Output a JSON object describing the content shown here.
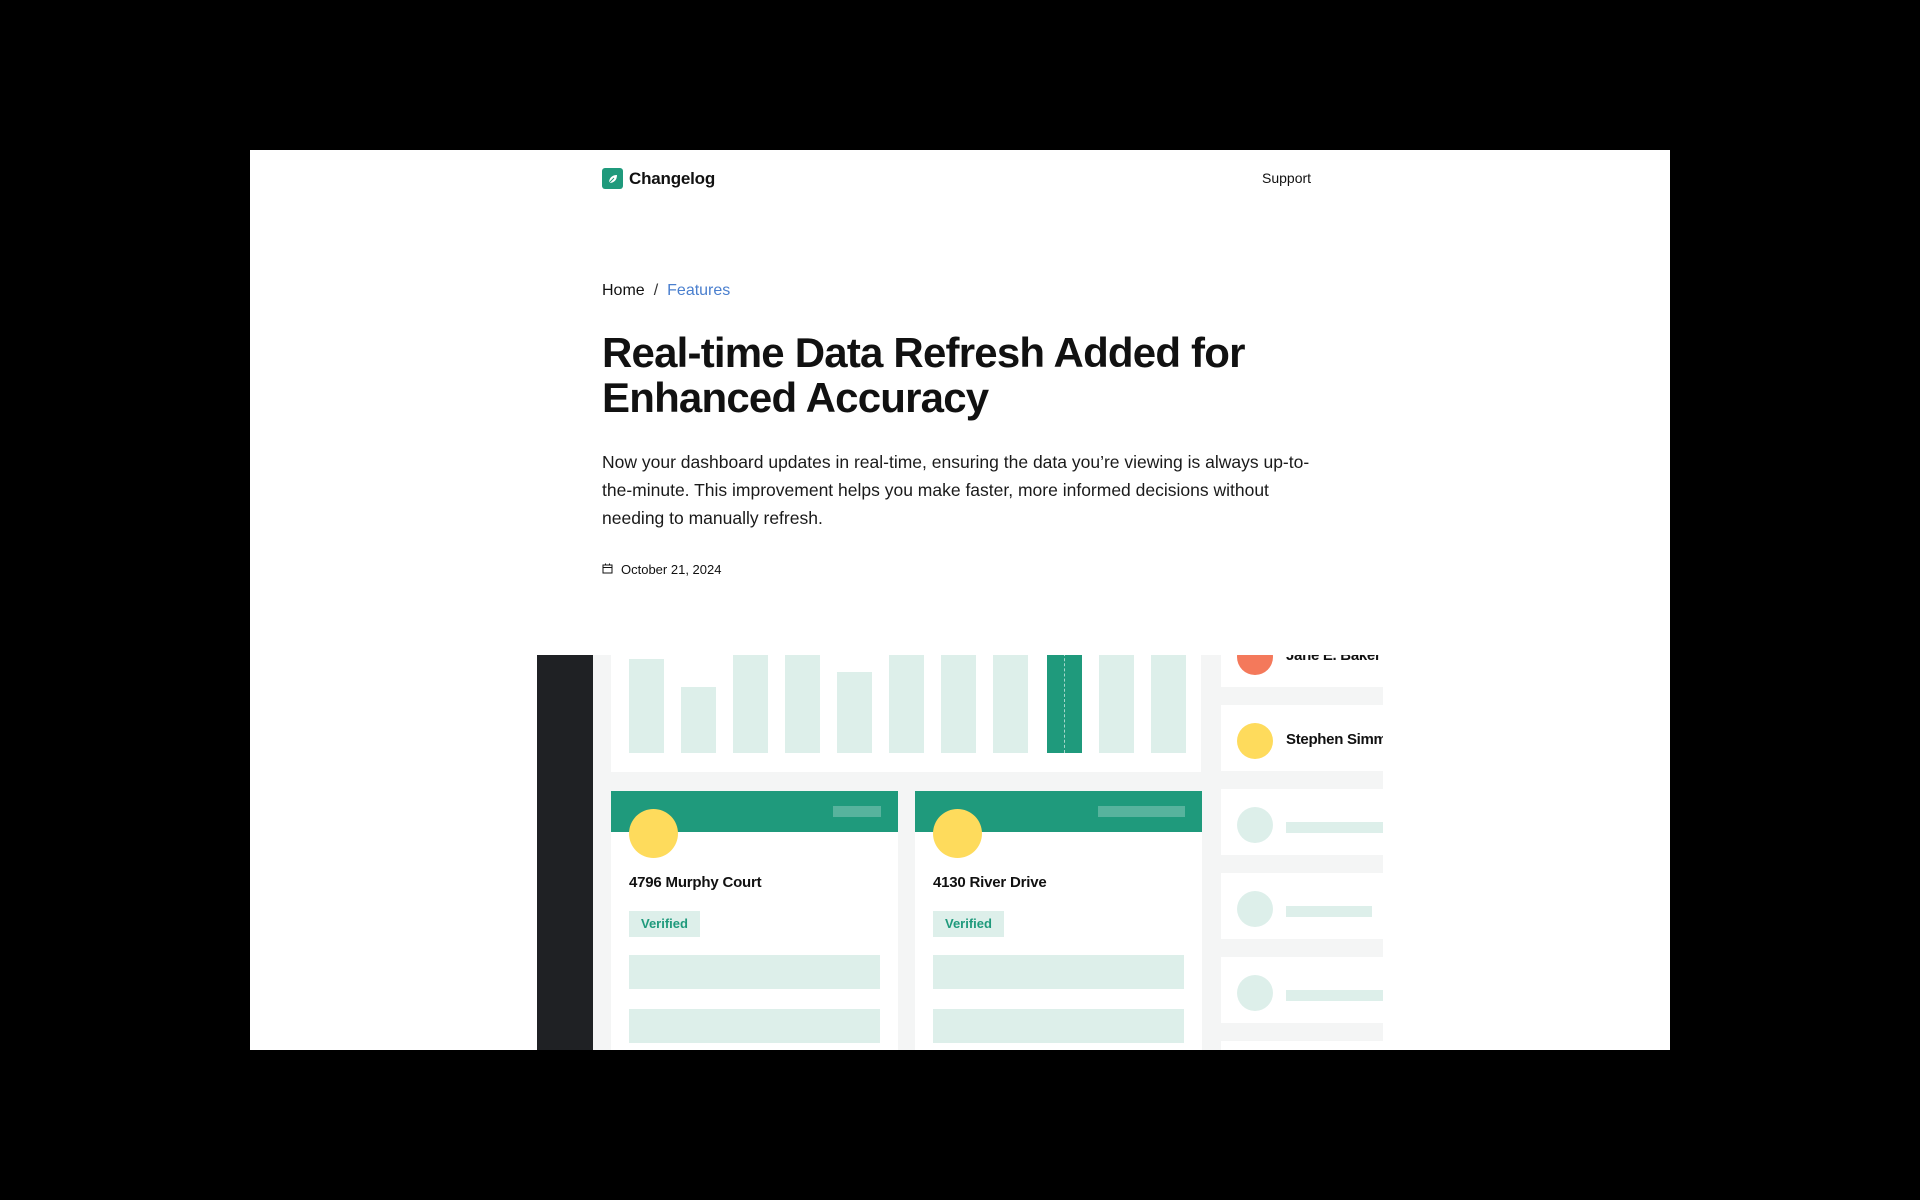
{
  "header": {
    "logo_text": "Changelog",
    "logo_icon": "leaf-icon",
    "support_label": "Support"
  },
  "breadcrumb": {
    "home": "Home",
    "separator": "/",
    "current": "Features"
  },
  "article": {
    "title": "Real-time Data Refresh Added for Enhanced Accuracy",
    "description": "Now your dashboard updates in real-time, ensuring the data you’re viewing is always up-to-the-minute. This improvement helps you make faster, more informed decisions without needing to manually refresh.",
    "date_icon": "calendar-icon",
    "date": "October 21, 2024"
  },
  "preview": {
    "cards": [
      {
        "title": "4796 Murphy Court",
        "badge": "Verified"
      },
      {
        "title": "4130 River Drive",
        "badge": "Verified"
      }
    ],
    "people": [
      {
        "name": "Jane E. Baker",
        "avatar_color": "#f4795b"
      },
      {
        "name": "Stephen Simm",
        "avatar_color": "#fedb5c"
      }
    ]
  },
  "colors": {
    "accent": "#1f9a7c",
    "accent_light": "#ddefea",
    "link": "#4a7fce",
    "avatar_yellow": "#fedb5c"
  }
}
